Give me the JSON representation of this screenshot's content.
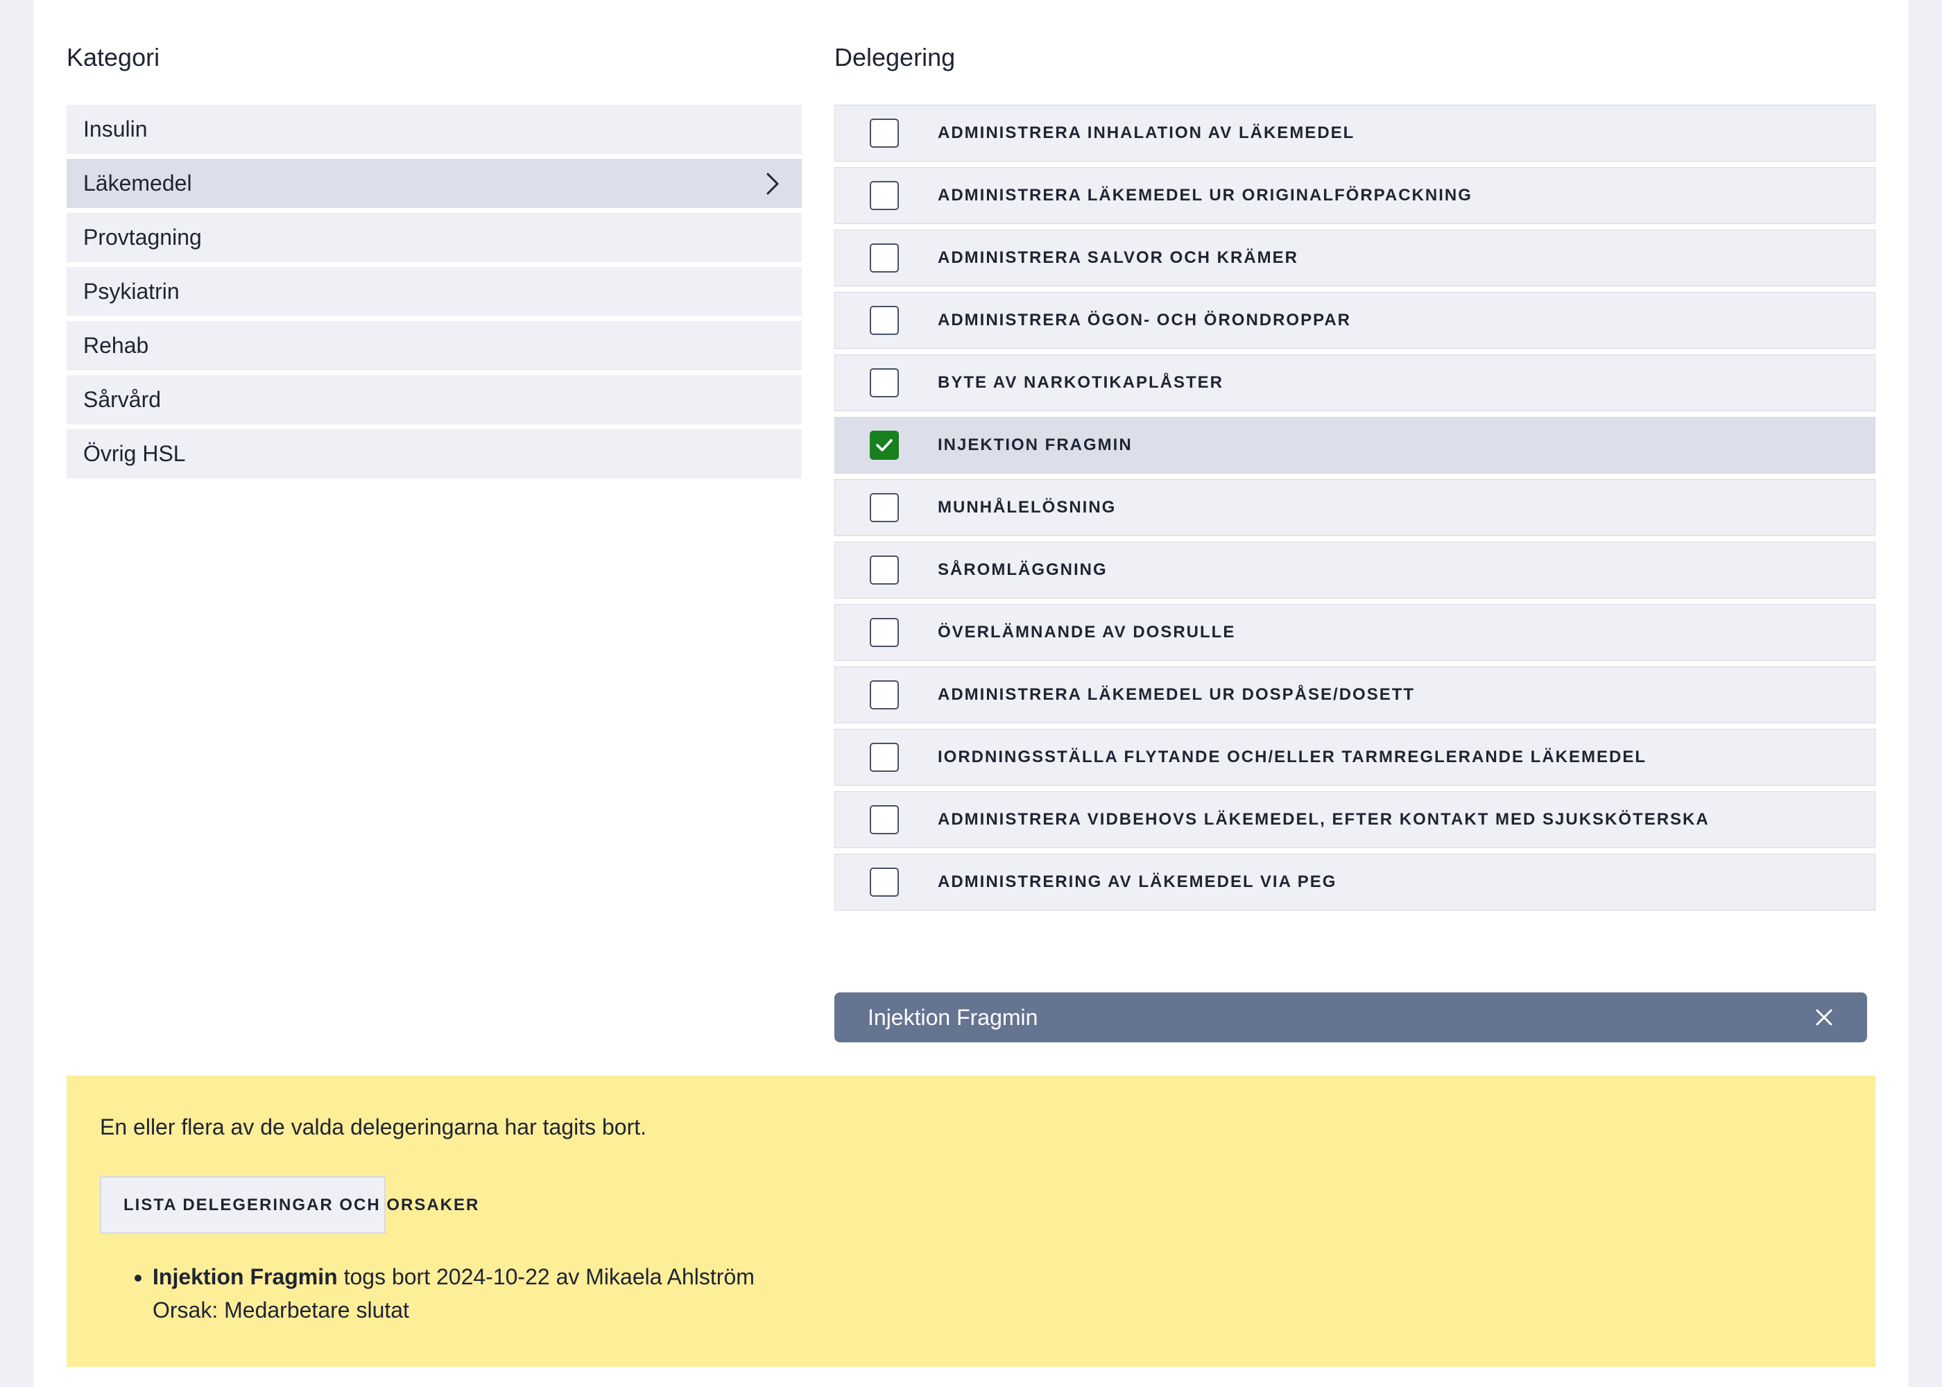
{
  "kategori": {
    "heading": "Kategori",
    "items": [
      {
        "label": "Insulin",
        "active": false
      },
      {
        "label": "Läkemedel",
        "active": true
      },
      {
        "label": "Provtagning",
        "active": false
      },
      {
        "label": "Psykiatrin",
        "active": false
      },
      {
        "label": "Rehab",
        "active": false
      },
      {
        "label": "Sårvård",
        "active": false
      },
      {
        "label": "Övrig HSL",
        "active": false
      }
    ]
  },
  "delegering": {
    "heading": "Delegering",
    "items": [
      {
        "label": "ADMINISTRERA INHALATION AV LÄKEMEDEL",
        "checked": false
      },
      {
        "label": "ADMINISTRERA LÄKEMEDEL UR ORIGINALFÖRPACKNING",
        "checked": false
      },
      {
        "label": "ADMINISTRERA SALVOR OCH KRÄMER",
        "checked": false
      },
      {
        "label": "ADMINISTRERA ÖGON- OCH ÖRONDROPPAR",
        "checked": false
      },
      {
        "label": "BYTE AV NARKOTIKAPLÅSTER",
        "checked": false
      },
      {
        "label": "INJEKTION FRAGMIN",
        "checked": true
      },
      {
        "label": "MUNHÅLELÖSNING",
        "checked": false
      },
      {
        "label": "SÅROMLÄGGNING",
        "checked": false
      },
      {
        "label": "ÖVERLÄMNANDE AV DOSRULLE",
        "checked": false
      },
      {
        "label": "ADMINISTRERA LÄKEMEDEL UR DOSPÅSE/DOSETT",
        "checked": false
      },
      {
        "label": "IORDNINGSSTÄLLA FLYTANDE OCH/ELLER TARMREGLERANDE LÄKEMEDEL",
        "checked": false
      },
      {
        "label": "ADMINISTRERA VIDBEHOVS LÄKEMEDEL, EFTER KONTAKT MED SJUKSKÖTERSKA",
        "checked": false
      },
      {
        "label": "ADMINISTRERING AV LÄKEMEDEL VIA PEG",
        "checked": false
      }
    ]
  },
  "selected_chip": {
    "label": "Injektion Fragmin"
  },
  "alert": {
    "message": "En eller flera av de valda delegeringarna har tagits bort.",
    "toggle_label": "LISTA DELEGERINGAR OCH ORSAKER",
    "removed": [
      {
        "name": "Injektion Fragmin",
        "detail": " togs bort 2024-10-22 av Mikaela Ahlström",
        "reason": "Orsak: Medarbetare slutat"
      }
    ]
  },
  "colors": {
    "page_bg": "#eef0f6",
    "item_bg": "#eff0f5",
    "item_active_bg": "#dcdfea",
    "checkbox_checked": "#18801f",
    "chip_bg": "#647491",
    "alert_bg": "#fdee98"
  },
  "icons": {
    "category_active": "chevron-right-icon",
    "checkbox_checked": "check-icon",
    "chip_close": "close-icon",
    "toggle": "chevron-up-icon"
  }
}
